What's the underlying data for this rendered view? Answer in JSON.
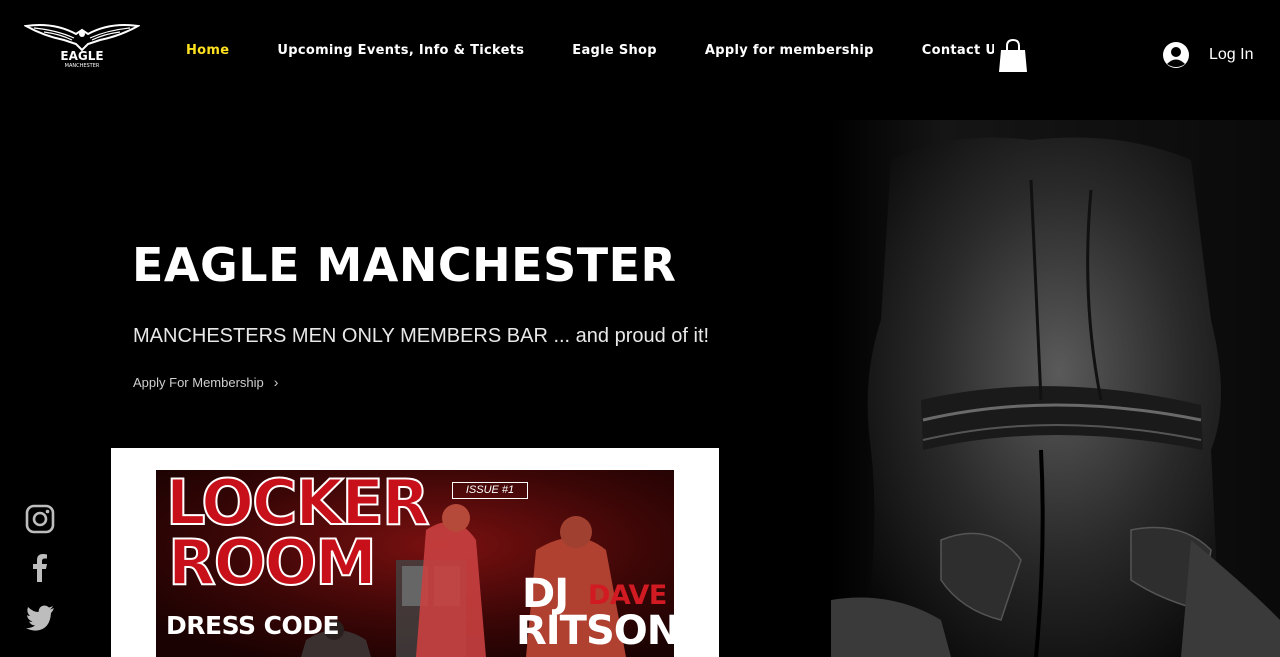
{
  "header": {
    "logo_text": "EAGLE",
    "logo_subtext": "MANCHESTER",
    "nav": [
      {
        "label": "Home",
        "active": true
      },
      {
        "label": "Upcoming Events, Info & Tickets",
        "active": false
      },
      {
        "label": "Eagle Shop",
        "active": false
      },
      {
        "label": "Apply for membership",
        "active": false
      },
      {
        "label": "Contact Us",
        "active": false
      }
    ],
    "cart_icon": "shopping-bag-icon",
    "login_label": "Log In",
    "login_icon": "user-avatar-icon"
  },
  "hero": {
    "title": "EAGLE MANCHESTER",
    "subtitle": "MANCHESTERS MEN ONLY MEMBERS BAR ... and proud of it!",
    "link_label": "Apply For Membership",
    "link_icon": "chevron-right-icon"
  },
  "poster": {
    "title_line1": "LOCKER",
    "title_line2": "ROOM",
    "issue": "ISSUE #1",
    "dress_code": "DRESS CODE",
    "dj_prefix": "DJ",
    "dj_first": "DAVE",
    "dj_last": "RITSON"
  },
  "social": [
    "instagram-icon",
    "facebook-icon",
    "twitter-icon"
  ],
  "colors": {
    "background": "#000000",
    "active_nav": "#ffe11f",
    "poster_red": "#c8101a"
  }
}
